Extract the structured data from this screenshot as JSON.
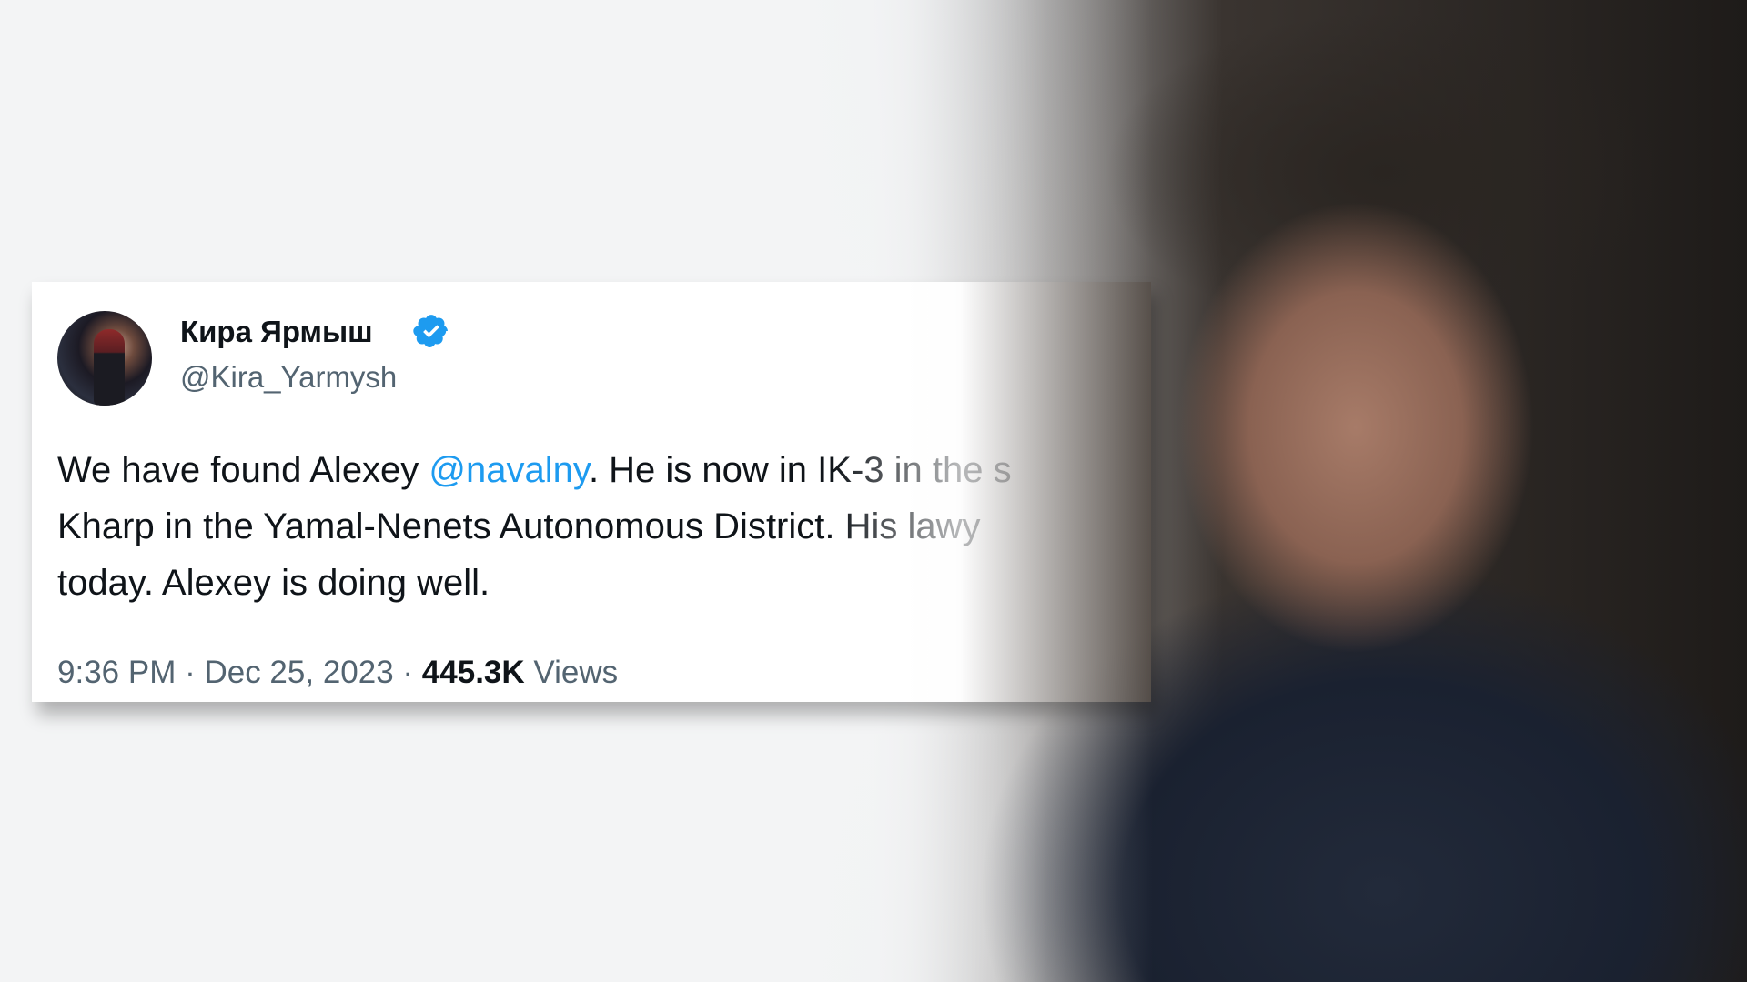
{
  "tweet": {
    "display_name": "Кира Ярмыш",
    "verified_icon": "verified-badge-icon",
    "handle": "@Kira_Yarmysh",
    "line1_a": "We have found Alexey ",
    "mention": "@navalny",
    "line1_b": ". He is now in IK-3 in the s",
    "line2": "Kharp in the Yamal-Nenets Autonomous District. His lawy",
    "line3": "today. Alexey is doing well.",
    "time": "9:36 PM",
    "sep1": " · ",
    "date": "Dec 25, 2023",
    "sep2": " · ",
    "views_count": "445.3K",
    "views_label": " Views"
  },
  "colors": {
    "text": "#0f1419",
    "secondary": "#536471",
    "mention": "#1d9bf0",
    "badge": "#1d9bf0"
  }
}
